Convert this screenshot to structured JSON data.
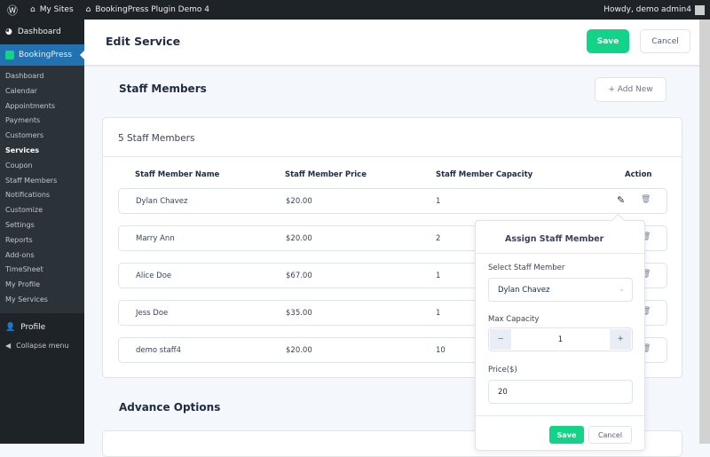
{
  "admin_bar": {
    "wp_icon": "wordpress-icon",
    "my_sites": "My Sites",
    "site_name": "BookingPress Plugin Demo 4",
    "howdy": "Howdy, demo admin4"
  },
  "sidebar": {
    "dashboard": "Dashboard",
    "plugin": "BookingPress",
    "items": [
      {
        "label": "Dashboard"
      },
      {
        "label": "Calendar"
      },
      {
        "label": "Appointments"
      },
      {
        "label": "Payments"
      },
      {
        "label": "Customers"
      },
      {
        "label": "Services",
        "current": true
      },
      {
        "label": "Coupon"
      },
      {
        "label": "Staff Members"
      },
      {
        "label": "Notifications"
      },
      {
        "label": "Customize"
      },
      {
        "label": "Settings"
      },
      {
        "label": "Reports"
      },
      {
        "label": "Add-ons"
      },
      {
        "label": "TimeSheet"
      },
      {
        "label": "My Profile"
      },
      {
        "label": "My Services"
      }
    ],
    "profile": "Profile",
    "collapse": "Collapse menu"
  },
  "header": {
    "title": "Edit Service",
    "save": "Save",
    "cancel": "Cancel"
  },
  "staff": {
    "title": "Staff Members",
    "add_new": "+ Add New",
    "count_label": "5 Staff Members",
    "columns": [
      "Staff Member Name",
      "Staff Member Price",
      "Staff Member Capacity",
      "Action"
    ],
    "rows": [
      {
        "name": "Dylan Chavez",
        "price": "$20.00",
        "capacity": "1"
      },
      {
        "name": "Marry Ann",
        "price": "$20.00",
        "capacity": "2"
      },
      {
        "name": "Alice Doe",
        "price": "$67.00",
        "capacity": "1"
      },
      {
        "name": "Jess Doe",
        "price": "$35.00",
        "capacity": "1"
      },
      {
        "name": "demo staff4",
        "price": "$20.00",
        "capacity": "10"
      }
    ]
  },
  "popover": {
    "title": "Assign Staff Member",
    "select_label": "Select Staff Member",
    "select_value": "Dylan Chavez",
    "capacity_label": "Max Capacity",
    "capacity_value": "1",
    "minus": "−",
    "plus": "+",
    "price_label": "Price($)",
    "price_value": "20",
    "save": "Save",
    "cancel": "Cancel"
  },
  "advance": {
    "title": "Advance Options"
  },
  "colors": {
    "accent": "#12d488",
    "admin_bar": "#1d2327",
    "active_menu": "#2271b1"
  }
}
